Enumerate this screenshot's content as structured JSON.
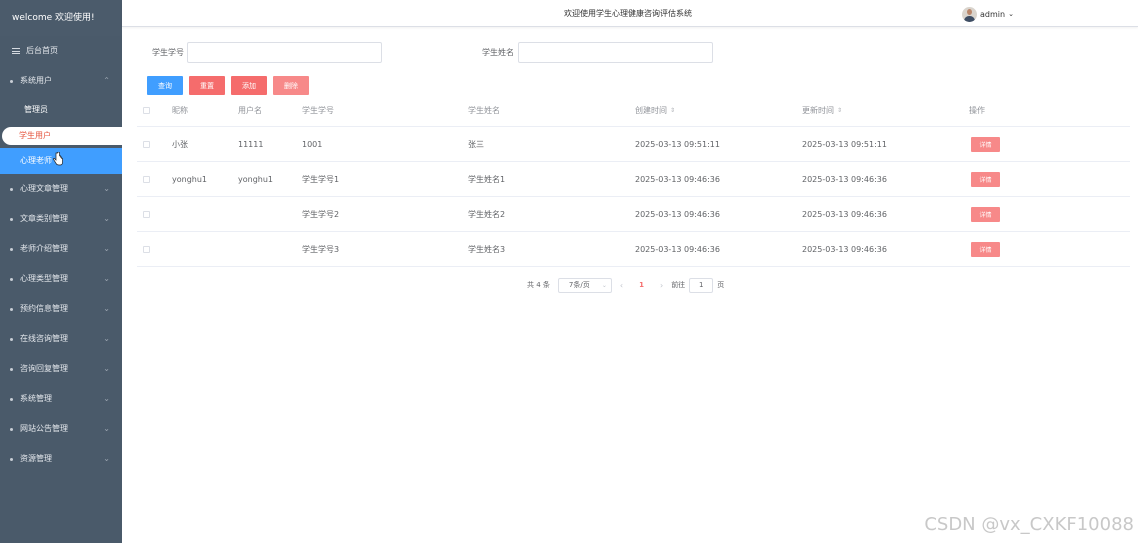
{
  "sidebar": {
    "welcome": "welcome 欢迎使用!",
    "home": "后台首页",
    "system_users": "系统用户",
    "sub_admin": "管理员",
    "sub_student": "学生用户",
    "sub_counselor": "心理老师",
    "items": [
      "心理文章管理",
      "文章类别管理",
      "老师介绍管理",
      "心理类型管理",
      "预约信息管理",
      "在线咨询管理",
      "咨询回复管理",
      "系统管理",
      "网站公告管理",
      "资源管理"
    ]
  },
  "header": {
    "title": "欢迎使用学生心理健康咨询评估系统",
    "username": "admin"
  },
  "search": {
    "student_no_label": "学生学号",
    "student_no_value": "",
    "student_name_label": "学生姓名",
    "student_name_value": ""
  },
  "toolbar": {
    "query": "查询",
    "reset": "重置",
    "add": "添加",
    "delete": "删除"
  },
  "table": {
    "headers": [
      "昵称",
      "用户名",
      "学生学号",
      "学生姓名",
      "创建时间",
      "更新时间",
      "操作"
    ],
    "rows": [
      [
        "小张",
        "11111",
        "1001",
        "张三",
        "2025-03-13 09:51:11",
        "2025-03-13 09:51:11"
      ],
      [
        "yonghu1",
        "yonghu1",
        "学生学号1",
        "学生姓名1",
        "2025-03-13 09:46:36",
        "2025-03-13 09:46:36"
      ],
      [
        "",
        "",
        "学生学号2",
        "学生姓名2",
        "2025-03-13 09:46:36",
        "2025-03-13 09:46:36"
      ],
      [
        "",
        "",
        "学生学号3",
        "学生姓名3",
        "2025-03-13 09:46:36",
        "2025-03-13 09:46:36"
      ]
    ],
    "detail_label": "详情"
  },
  "pagination": {
    "total": "共 4 条",
    "page_size": "7条/页",
    "current_page": "1",
    "goto_label": "前往",
    "goto_value": "1",
    "page_suffix": "页"
  },
  "watermark": "CSDN @vx_CXKF10088"
}
